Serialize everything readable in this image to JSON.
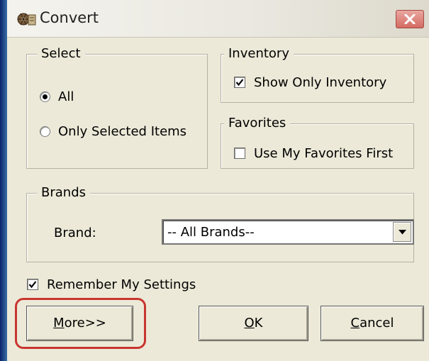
{
  "window": {
    "title": "Convert",
    "app_icon": "converter-app-icon",
    "close_icon": "close-icon"
  },
  "select_group": {
    "label": "Select",
    "options": [
      {
        "label": "All",
        "checked": true
      },
      {
        "label": "Only Selected Items",
        "checked": false
      }
    ]
  },
  "inventory_group": {
    "label": "Inventory",
    "checkbox_label": "Show Only Inventory",
    "checked": true
  },
  "favorites_group": {
    "label": "Favorites",
    "checkbox_label": "Use My Favorites First",
    "checked": false
  },
  "brands_group": {
    "label": "Brands",
    "field_label": "Brand:",
    "selected_value": "-- All Brands--"
  },
  "remember": {
    "label": "Remember My Settings",
    "checked": true
  },
  "buttons": {
    "more_mnemonic": "M",
    "more_rest": "ore>>",
    "ok_mnemonic": "O",
    "ok_rest": "K",
    "cancel_mnemonic": "C",
    "cancel_rest": "ancel"
  },
  "colors": {
    "dialog_background": "#ece9d8",
    "highlight_ring": "#c9352f",
    "close_button": "#d46b62"
  }
}
